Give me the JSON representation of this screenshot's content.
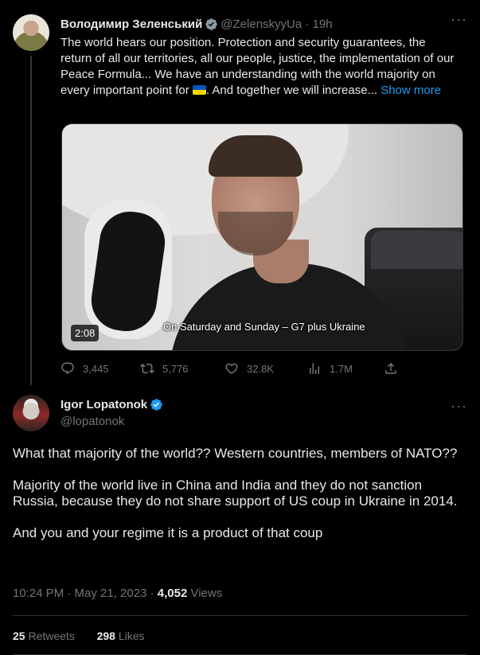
{
  "parent_tweet": {
    "author_name": "Володимир Зеленський",
    "handle": "@ZelenskyyUa",
    "time": "19h",
    "more_icon": "···",
    "text_before_flag": "The world hears our position. Protection and security guarantees, the return of all our territories, all our people, justice, the implementation of our Peace Formula... We have an understanding with the world majority on every important point for ",
    "text_after_flag": ". And together we will increase... ",
    "show_more": "Show more",
    "video": {
      "duration": "2:08",
      "caption": "On Saturday and Sunday – G7 plus Ukraine"
    },
    "actions": {
      "replies": "3,445",
      "retweets": "5,776",
      "likes": "32.8K",
      "views": "1.7M"
    }
  },
  "main_tweet": {
    "author_name": "Igor Lopatonok",
    "handle": "@lopatonok",
    "more_icon": "···",
    "paragraphs": [
      "What that majority of the world?? Western countries, members of NATO??",
      "Majority of the world live in China and India and they do not sanction Russia, because they do not share support of US coup in Ukraine in 2014.",
      "And you and your regime it is a product of that coup"
    ],
    "timestamp": "10:24 PM · May 21, 2023 · ",
    "views_count": "4,052",
    "views_label": " Views",
    "retweets_count": "25",
    "retweets_label": " Retweets",
    "likes_count": "298",
    "likes_label": " Likes"
  },
  "colors": {
    "background": "#000000",
    "text": "#e7e9ea",
    "muted": "#71767b",
    "accent": "#1d9bf0",
    "divider": "#2f3336"
  }
}
